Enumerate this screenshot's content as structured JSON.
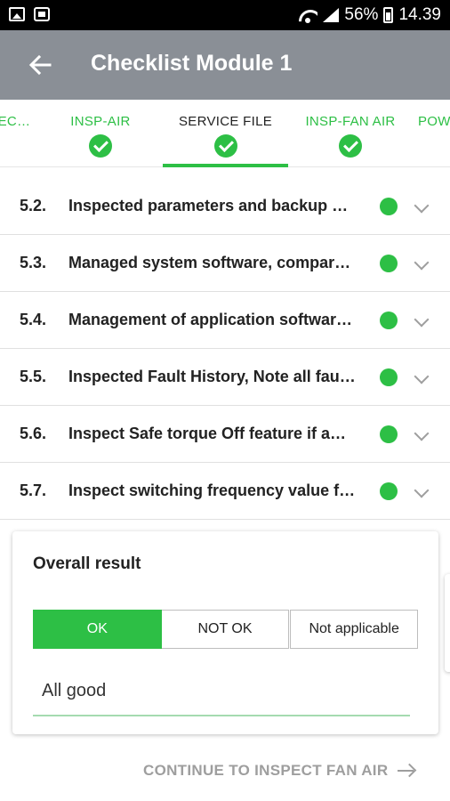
{
  "status_bar": {
    "battery": "56%",
    "time": "14.39",
    "icons": [
      "image-icon",
      "calendar-icon",
      "wifi-icon",
      "signal-icon",
      "battery-icon"
    ]
  },
  "app_bar": {
    "title": "Checklist Module 1",
    "back_icon": "arrow-back-icon"
  },
  "tabs": [
    {
      "label": "EC…",
      "done": true
    },
    {
      "label": "INSP-AIR",
      "done": true
    },
    {
      "label": "SERVICE FILE",
      "done": true,
      "active": true
    },
    {
      "label": "INSP-FAN AIR",
      "done": true
    },
    {
      "label": "POW",
      "done": false
    }
  ],
  "items": [
    {
      "num": "5.2.",
      "text": "Inspected parameters and backup …",
      "status": "ok"
    },
    {
      "num": "5.3.",
      "text": "Managed system software, compar…",
      "status": "ok"
    },
    {
      "num": "5.4.",
      "text": "Management of application softwar…",
      "status": "ok"
    },
    {
      "num": "5.5.",
      "text": "Inspected Fault History, Note all fau…",
      "status": "ok"
    },
    {
      "num": "5.6.",
      "text": "Inspect Safe torque Off feature if a…",
      "status": "ok"
    },
    {
      "num": "5.7.",
      "text": "Inspect switching frequency value f…",
      "status": "ok"
    }
  ],
  "overall": {
    "title": "Overall result",
    "options": [
      "OK",
      "NOT OK",
      "Not applicable"
    ],
    "selected": "OK",
    "comment": "All good"
  },
  "continue_label": "CONTINUE TO INSPECT FAN AIR",
  "colors": {
    "accent": "#2dbf45",
    "app_bar": "#8a8f96",
    "muted": "#9e9e9e"
  }
}
